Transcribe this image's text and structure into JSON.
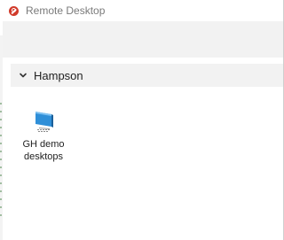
{
  "window": {
    "title": "Remote Desktop"
  },
  "group": {
    "label": "Hampson",
    "expanded": true
  },
  "tiles": [
    {
      "label_line1": "GH demo",
      "label_line2": "desktops",
      "icon": "monitor-icon"
    }
  ],
  "colors": {
    "app_icon": "#d13a2a",
    "monitor_screen": "#2f8fd8",
    "bar_background": "#f2f2f2"
  }
}
